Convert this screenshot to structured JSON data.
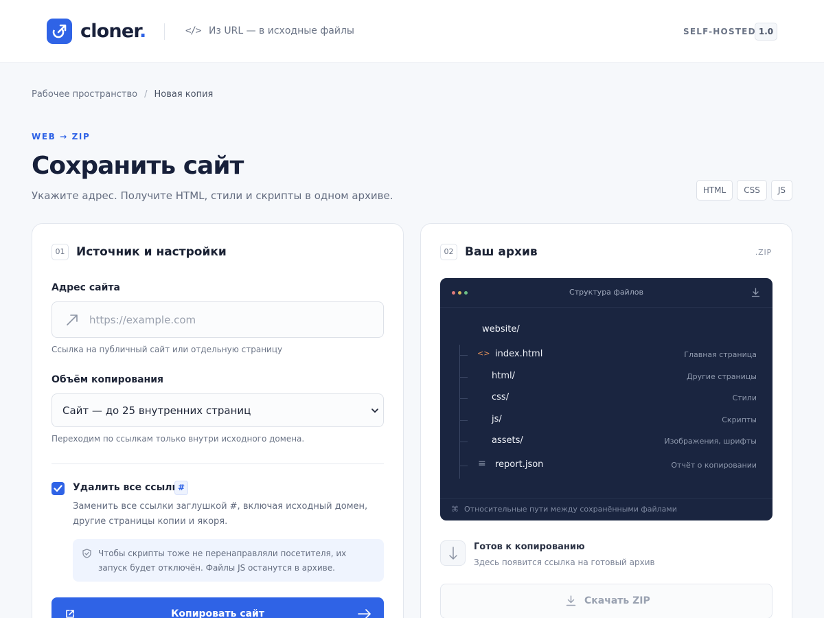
{
  "header": {
    "logo_text": "cloner",
    "logo_dot": ".",
    "tagline_icon": "</>",
    "tagline": "Из URL — в исходные файлы",
    "badge": "SELF-HOSTED",
    "version": "1.0"
  },
  "breadcrumb": {
    "items": [
      "Рабочее пространство",
      "Новая копия"
    ],
    "separator": "/"
  },
  "hero": {
    "eyebrow": "WEB → ZIP",
    "title": "Сохранить сайт",
    "subtitle": "Укажите адрес. Получите HTML, стили и скрипты в одном архиве.",
    "chips": [
      "HTML",
      "CSS",
      "JS"
    ]
  },
  "source_card": {
    "step": "01",
    "title": "Источник и настройки",
    "url_label": "Адрес сайта",
    "url_value": "",
    "url_placeholder": "https://example.com",
    "url_hint": "Ссылка на публичный сайт или отдельную страницу",
    "scope_label": "Объём копирования",
    "scope_value": "Сайт — до 25 внутренних страниц",
    "scope_hint": "Переходим по ссылкам только внутри исходного домена.",
    "remove_links": {
      "checked": true,
      "label": "Удалить все ссылки",
      "badge": "#",
      "description": "Заменить все ссылки заглушкой #, включая исходный домен, другие страницы копии и якоря."
    },
    "notice": "Чтобы скрипты тоже не перенаправляли посетителя, их запуск будет отключён. Файлы JS останутся в архиве.",
    "submit_label": "Копировать сайт"
  },
  "archive_card": {
    "step": "02",
    "title": "Ваш архив",
    "tag": ".ZIP",
    "tree": {
      "title": "Структура файлов",
      "root": "website/",
      "items": [
        {
          "name": "index.html",
          "icon": "<>",
          "description": "Главная страница"
        },
        {
          "name": "html/",
          "icon": "",
          "description": "Другие страницы"
        },
        {
          "name": "css/",
          "icon": "",
          "description": "Стили"
        },
        {
          "name": "js/",
          "icon": "",
          "description": "Скрипты"
        },
        {
          "name": "assets/",
          "icon": "",
          "description": "Изображения, шрифты"
        },
        {
          "name": "report.json",
          "icon": "≡",
          "description": "Отчёт о копировании"
        }
      ],
      "footer_icon": "⌘",
      "footer": "Относительные пути между сохранёнными файлами"
    },
    "status_title": "Готов к копированию",
    "status_subtitle": "Здесь появится ссылка на готовый архив",
    "download_label": "Скачать ZIP"
  },
  "colors": {
    "accent": "#2f63e6",
    "panel": "#1a2540",
    "page_bg": "#f6f8fb",
    "file_icon_html": "#e8955b",
    "dot_red": "#e07a7a",
    "dot_yellow": "#d6b65c",
    "dot_green": "#6cbf86"
  },
  "icons": {
    "logo": "arrow-out-icon",
    "url_field": "arrow-up-right-icon",
    "notice": "shield-icon",
    "submit": "external-link-icon",
    "submit_trailing": "arrow-right-icon",
    "tree_download": "download-icon",
    "status": "arrow-down-icon",
    "download": "download-icon"
  }
}
